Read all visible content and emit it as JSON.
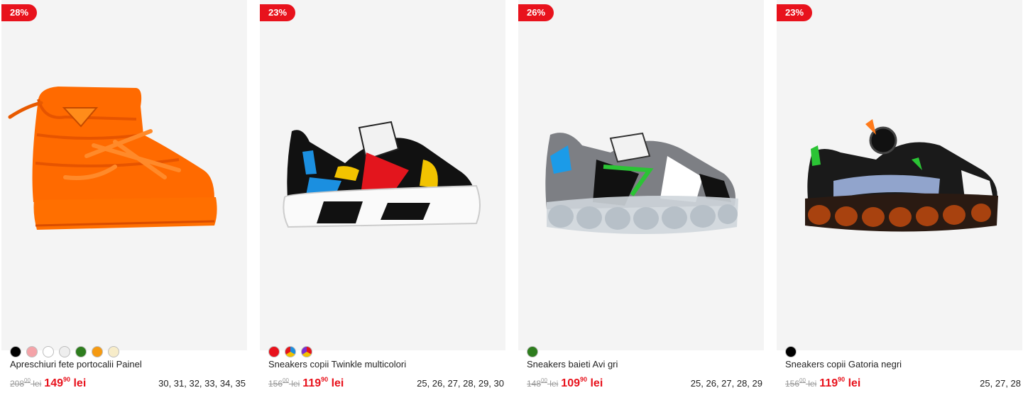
{
  "products": [
    {
      "discount": "28%",
      "title": "Apreschiuri fete portocalii Painel",
      "old_int": "208",
      "old_dec": "00",
      "old_cur": "lei",
      "new_int": "149",
      "new_dec": "90",
      "new_cur": "lei",
      "sizes": "30, 31, 32, 33, 34, 35",
      "swatches": [
        "#000000",
        "#f4a3a8",
        "#ffffff",
        "#eeeeee",
        "#2e7d1e",
        "#f59a12",
        "#f7ecc9"
      ],
      "icon": "orange-snow-boot-image"
    },
    {
      "discount": "23%",
      "title": "Sneakers copii Twinkle multicolori",
      "old_int": "156",
      "old_dec": "00",
      "old_cur": "lei",
      "new_int": "119",
      "new_dec": "90",
      "new_cur": "lei",
      "sizes": "25, 26, 27, 28, 29, 30",
      "swatches": [
        "#e8121c",
        "multi",
        "multi"
      ],
      "icon": "multicolor-sneaker-image"
    },
    {
      "discount": "26%",
      "title": "Sneakers baieti Avi gri",
      "old_int": "148",
      "old_dec": "00",
      "old_cur": "lei",
      "new_int": "109",
      "new_dec": "90",
      "new_cur": "lei",
      "sizes": "25, 26, 27, 28, 29",
      "swatches": [
        "#2e7d1e"
      ],
      "icon": "grey-sneaker-image"
    },
    {
      "discount": "23%",
      "title": "Sneakers copii Gatoria negri",
      "old_int": "156",
      "old_dec": "00",
      "old_cur": "lei",
      "new_int": "119",
      "new_dec": "90",
      "new_cur": "lei",
      "sizes": "25, 27, 28",
      "swatches": [
        "#000000"
      ],
      "icon": "black-sneaker-image"
    }
  ]
}
